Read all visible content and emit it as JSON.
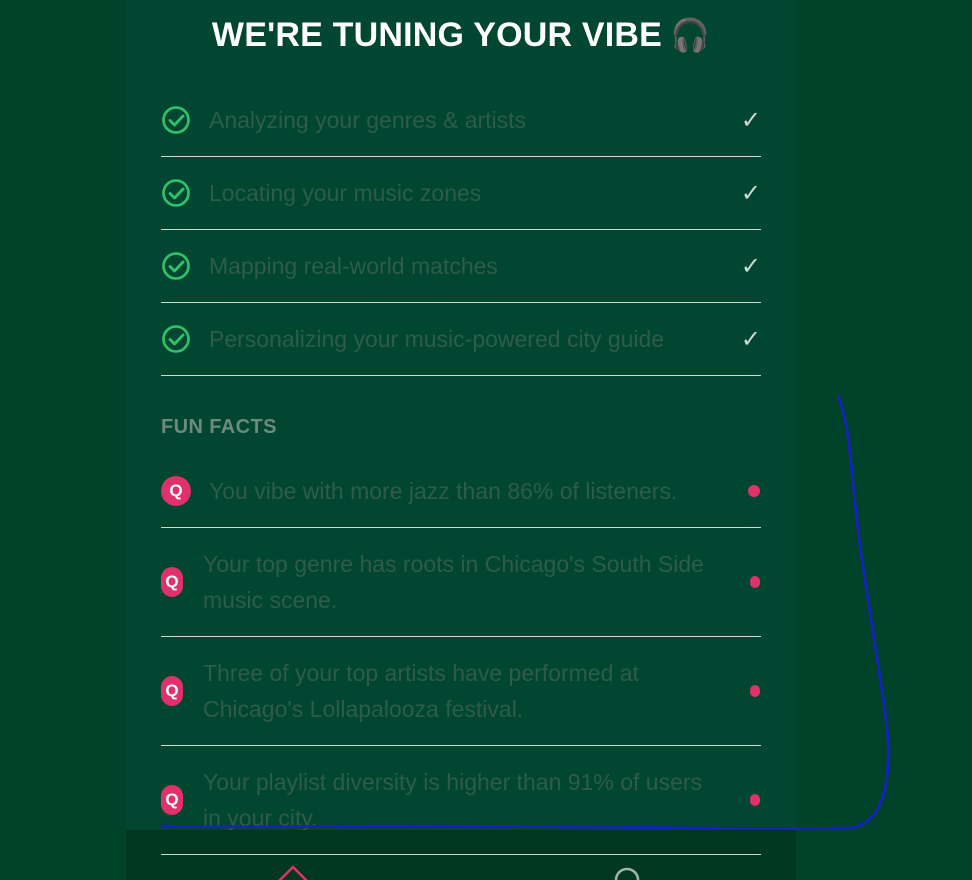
{
  "header": {
    "title": "WE'RE TUNING YOUR VIBE",
    "title_emoji": "🎧"
  },
  "steps": [
    {
      "label": "Analyzing your genres & artists",
      "check_glyph": "✓",
      "icon": "check-circle-icon"
    },
    {
      "label": "Locating your music zones",
      "check_glyph": "✓",
      "icon": "check-circle-icon"
    },
    {
      "label": "Mapping real-world matches",
      "check_glyph": "✓",
      "icon": "check-circle-icon"
    },
    {
      "label": "Personalizing your music-powered city guide",
      "check_glyph": "✓",
      "icon": "check-circle-icon"
    }
  ],
  "fun_facts": {
    "heading": "FUN FACTS",
    "badge_letter": "Q",
    "items": [
      {
        "text": "You vibe with more jazz than 86% of listeners."
      },
      {
        "text": "Your top genre has roots in Chicago's South Side music scene."
      },
      {
        "text": "Three of your top artists have performed at Chicago's Lollapalooza festival."
      },
      {
        "text": "Your playlist diversity is higher than 91% of users in your city."
      }
    ]
  },
  "bottom_nav": {
    "items": [
      {
        "icon": "home-icon"
      },
      {
        "icon": "search-icon"
      }
    ]
  },
  "colors": {
    "background": "#00432a",
    "accent_green": "#2fc46a",
    "accent_pink": "#e0316a",
    "annotation_ink": "#1720c8"
  }
}
